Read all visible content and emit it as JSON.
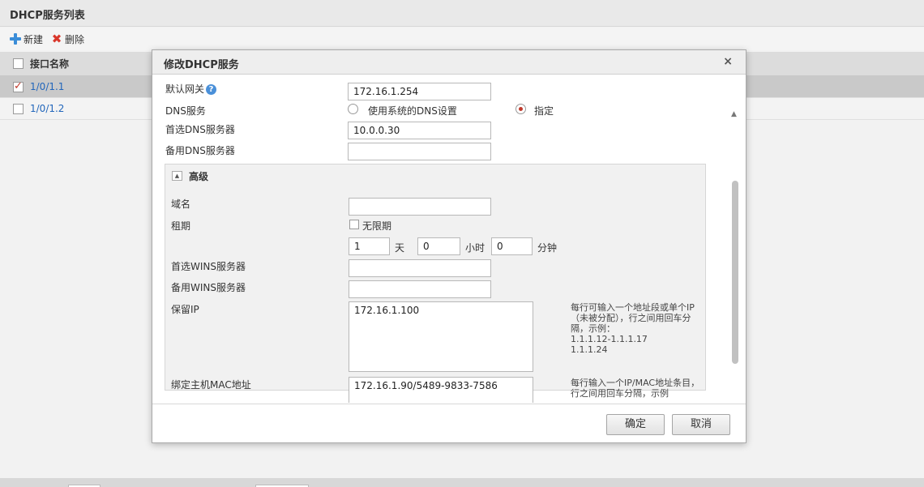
{
  "page": {
    "title": "DHCP服务列表"
  },
  "toolbar": {
    "add_label": "新建",
    "delete_label": "删除"
  },
  "grid": {
    "header": "接口名称",
    "rows": [
      {
        "name": "1/0/1.1",
        "checked": true
      },
      {
        "name": "1/0/1.2",
        "checked": false
      }
    ]
  },
  "modal": {
    "title": "修改DHCP服务",
    "close": "×",
    "gateway_label": "默认网关",
    "gateway_help": "?",
    "gateway_value": "172.16.1.254",
    "dns_label": "DNS服务",
    "dns_option_system": "使用系统的DNS设置",
    "dns_option_specify": "指定",
    "dns_selected": "指定",
    "primary_dns_label": "首选DNS服务器",
    "primary_dns_value": "10.0.0.30",
    "secondary_dns_label": "备用DNS服务器",
    "secondary_dns_value": "",
    "advanced": {
      "title": "高级",
      "toggle_icon": "▲",
      "domain_label": "域名",
      "domain_value": "",
      "lease_label": "租期",
      "unlimited_label": "无限期",
      "days_value": "1",
      "days_unit": "天",
      "hours_value": "0",
      "hours_unit": "小时",
      "minutes_value": "0",
      "minutes_unit": "分钟",
      "primary_wins_label": "首选WINS服务器",
      "primary_wins_value": "",
      "secondary_wins_label": "备用WINS服务器",
      "secondary_wins_value": "",
      "reserved_ip_label": "保留IP",
      "reserved_ip_value": "172.16.1.100",
      "reserved_ip_hint": "每行可输入一个地址段或单个IP（未被分配），行之间用回车分隔，示例：\n1.1.1.12-1.1.1.17\n1.1.1.24",
      "mac_bind_label": "绑定主机MAC地址",
      "mac_bind_value": "172.16.1.90/5489-9833-7586",
      "mac_bind_hint": "每行输入一个IP/MAC地址条目，行之间用回车分隔，示例"
    },
    "ok_label": "确定",
    "cancel_label": "取消"
  }
}
